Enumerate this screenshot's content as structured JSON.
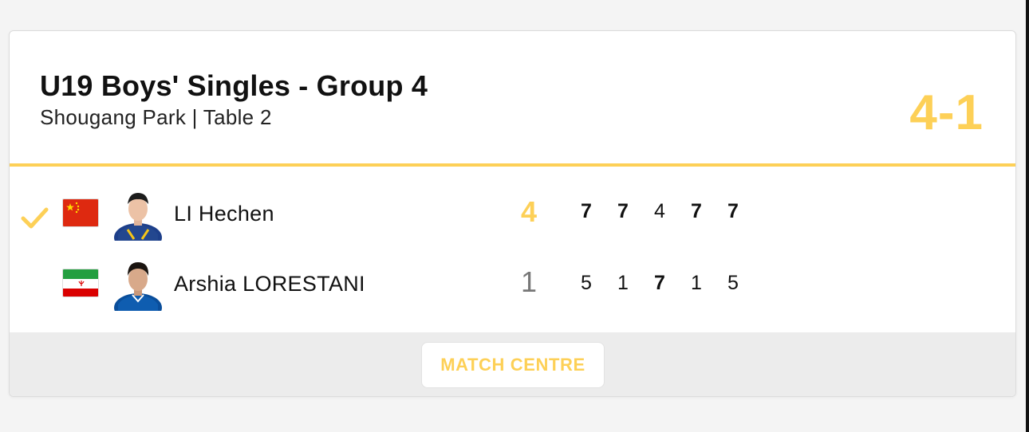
{
  "match": {
    "title": "U19 Boys' Singles - Group 4",
    "subtitle": "Shougang Park | Table 2",
    "overall_score": "4-1"
  },
  "players": [
    {
      "name": "LI Hechen",
      "country_flag_icon": "china-flag-icon",
      "winner": true,
      "total": "4",
      "games": [
        "7",
        "7",
        "4",
        "7",
        "7"
      ]
    },
    {
      "name": "Arshia LORESTANI",
      "country_flag_icon": "iran-flag-icon",
      "winner": false,
      "total": "1",
      "games": [
        "5",
        "1",
        "7",
        "1",
        "5"
      ]
    }
  ],
  "footer": {
    "match_centre_label": "MATCH CENTRE"
  },
  "colors": {
    "accent": "#fdd057",
    "text": "#111111",
    "muted": "#777777",
    "footer_bg": "#ececec"
  }
}
